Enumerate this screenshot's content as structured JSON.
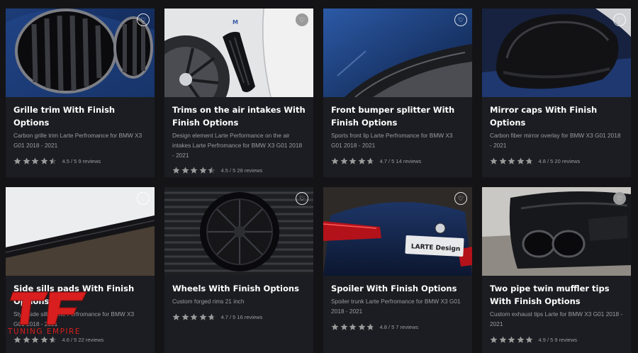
{
  "products": [
    {
      "title": "Grille trim With Finish Options",
      "desc": "Carbon grille trim Larte Perfromance for BMW X3 G01 2018 - 2021",
      "rating": 4.5,
      "rating_text": "4.5 / 5 9 reviews",
      "fav_filled": false
    },
    {
      "title": "Trims on the air intakes With Finish Options",
      "desc": "Design element Larte Performance on the air intakes Larte Perfromance for BMW X3 G01 2018 - 2021",
      "rating": 4.5,
      "rating_text": "4.5 / 5 28 reviews",
      "fav_filled": true
    },
    {
      "title": "Front bumper splitter With Finish Options",
      "desc": "Sports front lip Larte Perfromance for BMW X3 G01 2018 - 2021",
      "rating": 4.7,
      "rating_text": "4.7 / 5 14 reviews",
      "fav_filled": false
    },
    {
      "title": "Mirror caps With Finish Options",
      "desc": "Carbon fiber mirror overlay for BMW X3 G01 2018 - 2021",
      "rating": 4.8,
      "rating_text": "4.8 / 5 20 reviews",
      "fav_filled": false
    },
    {
      "title": "Side sills pads With Finish Options",
      "desc": "Style side sills Larte Perfromance for BMW X3 G01 2018 - 2021",
      "rating": 4.6,
      "rating_text": "4.6 / 5 22 reviews",
      "fav_filled": false
    },
    {
      "title": "Wheels With Finish Options",
      "desc": "Custom forged rims 21 inch",
      "rating": 4.7,
      "rating_text": "4.7 / 5 16 reviews",
      "fav_filled": false
    },
    {
      "title": "Spoiler With Finish Options",
      "desc": "Spoiler trunk Larte Perfromance for BMW X3 G01 2018 - 2021",
      "rating": 4.8,
      "rating_text": "4.8 / 5 7 reviews",
      "fav_filled": false
    },
    {
      "title": "Two pipe twin muffler tips With Finish Options",
      "desc": "Custom exhaust tips Larte for BMW X3 G01 2018 - 2021",
      "rating": 4.9,
      "rating_text": "4.9 / 5 9 reviews",
      "fav_filled": true
    }
  ],
  "image_badges": {
    "bmw_badge": "M",
    "plate_text": "LARTE Design"
  },
  "watermark": {
    "text": "TUNING EMPIRE"
  },
  "colors": {
    "background": "#141417",
    "card": "#1c1d22",
    "star": "#9a9a9a",
    "star_empty": "#4a4b50",
    "logo_red": "#d81e1e",
    "description": "#9b9ca3"
  },
  "icons": {
    "favorite": "heart-icon",
    "rating": "star-icon"
  }
}
